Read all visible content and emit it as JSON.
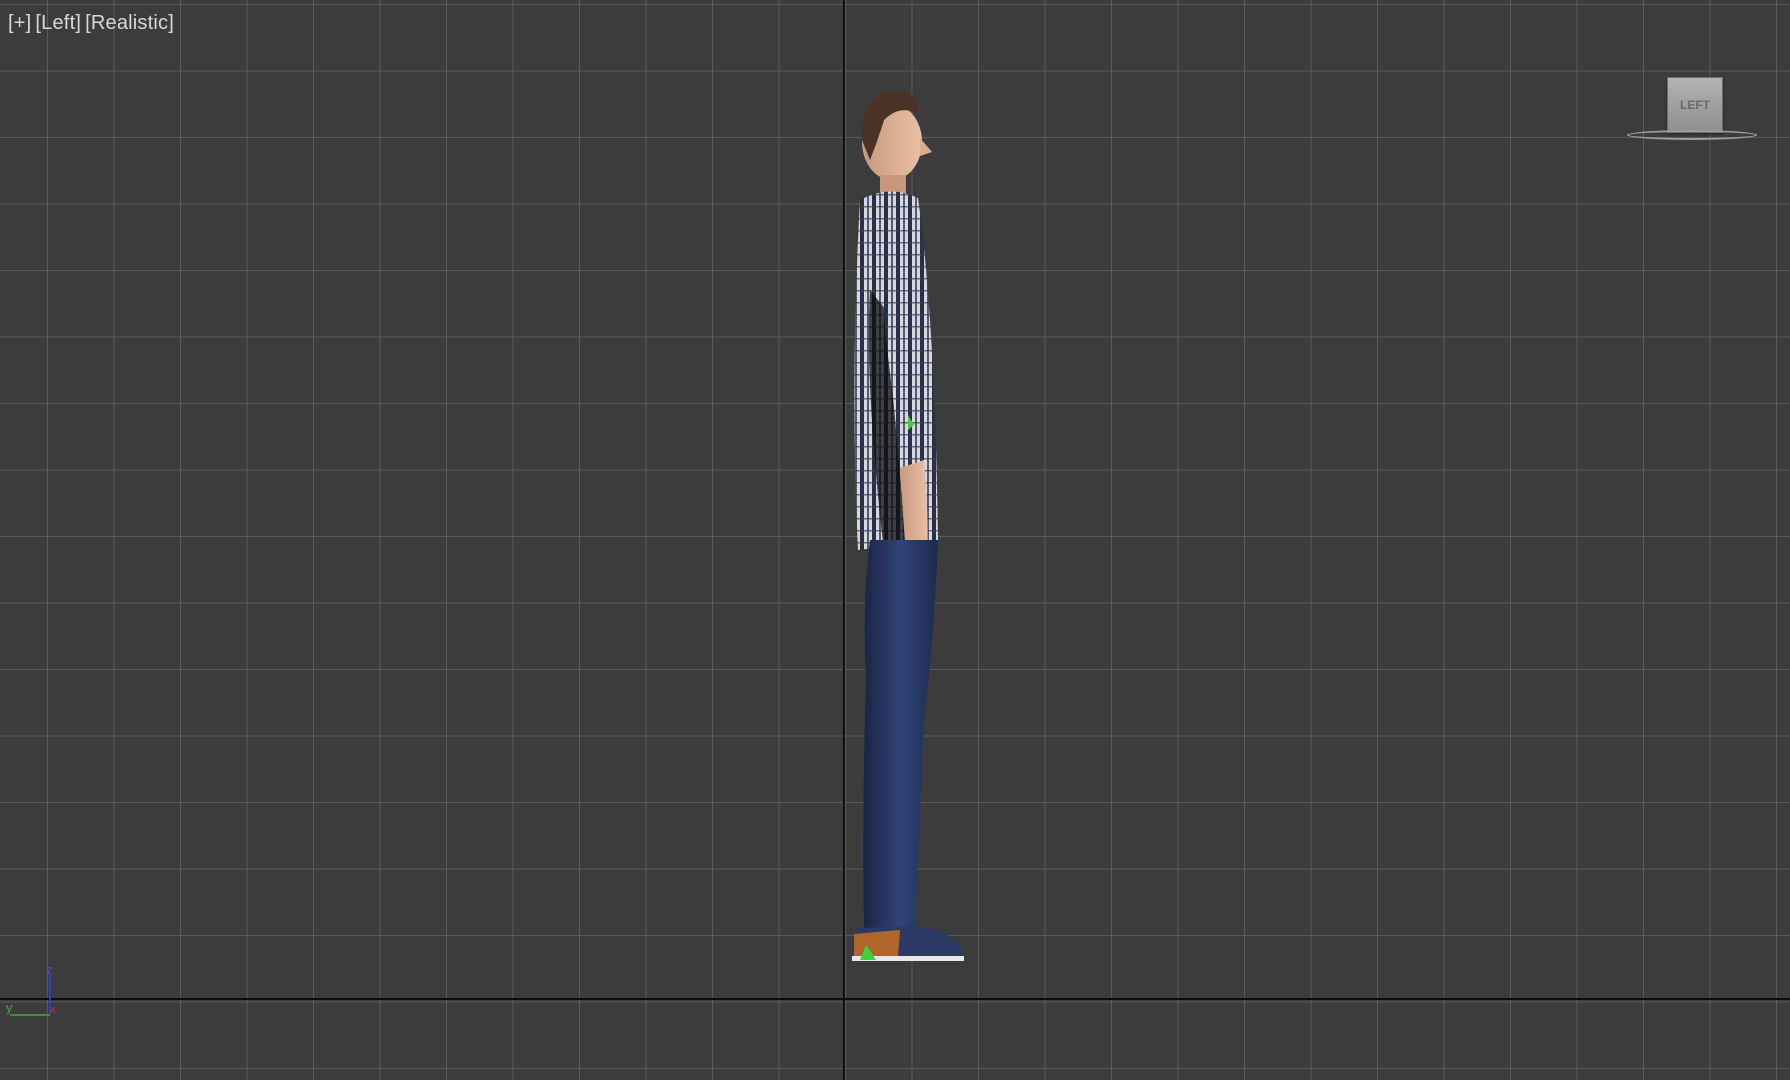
{
  "viewport": {
    "labels": [
      "[+]",
      "[Left]",
      "[Realistic]"
    ],
    "background_color": "#3c3c3c",
    "grid_color": "#5a5a5a"
  },
  "viewcube": {
    "face_label": "LEFT"
  },
  "axis_gizmo": {
    "z_label": "z",
    "y_label": "y",
    "x_label": "x"
  },
  "scene_object": {
    "type": "human-character-model",
    "shirt": "plaid",
    "pants": "jeans",
    "shoes": "sneakers"
  }
}
